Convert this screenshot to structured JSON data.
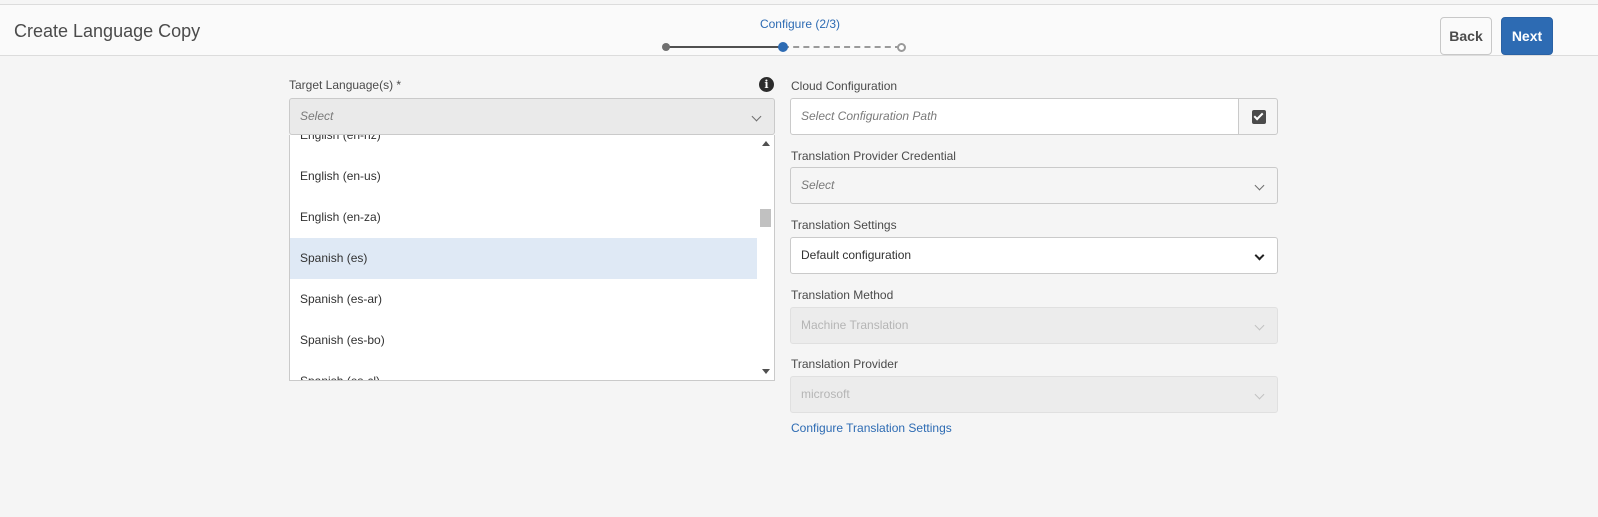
{
  "header": {
    "title": "Create Language Copy",
    "step_label": "Configure (2/3)",
    "back_label": "Back",
    "next_label": "Next"
  },
  "target_language": {
    "label": "Target Language(s) *",
    "placeholder": "Select",
    "options": [
      "English (en-nz)",
      "English (en-us)",
      "English (en-za)",
      "Spanish (es)",
      "Spanish (es-ar)",
      "Spanish (es-bo)",
      "Spanish (es-cl)"
    ],
    "highlighted": "Spanish (es)"
  },
  "cloud_configuration": {
    "label": "Cloud Configuration",
    "placeholder": "Select Configuration Path"
  },
  "provider_credential": {
    "label": "Translation Provider Credential",
    "placeholder": "Select"
  },
  "translation_settings": {
    "label": "Translation Settings",
    "value": "Default configuration"
  },
  "translation_method": {
    "label": "Translation Method",
    "value": "Machine Translation"
  },
  "translation_provider": {
    "label": "Translation Provider",
    "value": "microsoft"
  },
  "configure_link": "Configure Translation Settings",
  "colors": {
    "accent": "#2d6bb3",
    "selected_row": "#dfe9f5",
    "background": "#f5f5f5"
  }
}
